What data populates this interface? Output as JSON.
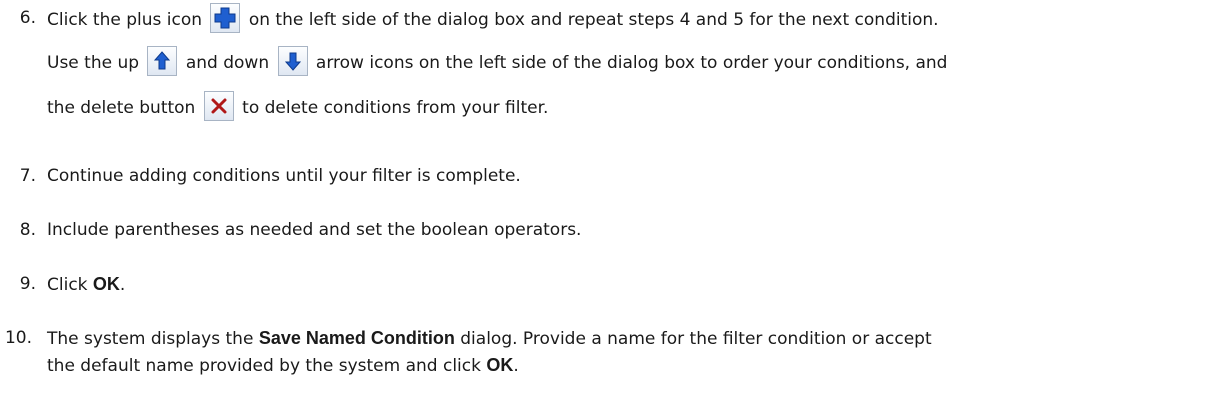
{
  "steps": [
    {
      "number": "6.",
      "line1": {
        "before": "Click the plus icon",
        "after": "on the left side of the dialog box and repeat steps 4 and 5 for the next condition."
      },
      "line2": {
        "before": "Use the up",
        "middle": "and down",
        "after": "arrow icons on the left side of the dialog box to order your conditions, and"
      },
      "line3": {
        "before": "the delete button",
        "after": "to delete conditions from your filter."
      }
    },
    {
      "number": "7.",
      "text": "Continue adding conditions until your filter is complete."
    },
    {
      "number": "8.",
      "text": "Include parentheses as needed and set the boolean operators."
    },
    {
      "number": "9.",
      "before": "Click",
      "bold": "OK",
      "after": "."
    },
    {
      "number": "10.",
      "line1": {
        "before": "The system displays the",
        "bold": "Save Named Condition",
        "after": "dialog. Provide a name for the filter condition or accept"
      },
      "line2": {
        "before": "the default name provided by the system and click",
        "bold": "OK",
        "after": "."
      }
    }
  ],
  "icons": {
    "plus": "plus-icon",
    "up": "arrow-up-icon",
    "down": "arrow-down-icon",
    "delete": "delete-x-icon"
  },
  "colors": {
    "icon_blue": "#1f5fd0",
    "delete_red": "#b01818",
    "text": "#1a1a1a"
  }
}
